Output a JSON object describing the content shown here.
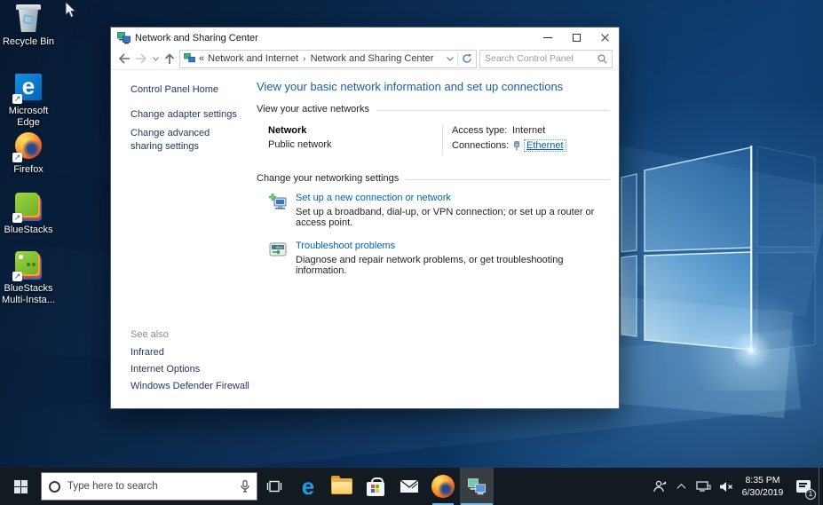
{
  "desktop": {
    "icons": [
      {
        "label": "Recycle Bin"
      },
      {
        "label": "Microsoft Edge"
      },
      {
        "label": "Firefox"
      },
      {
        "label": "BlueStacks"
      },
      {
        "label": "BlueStacks Multi-Insta..."
      }
    ]
  },
  "window": {
    "title": "Network and Sharing Center",
    "breadcrumb": {
      "chevrons": "«",
      "segment1": "Network and Internet",
      "divider": "›",
      "segment2": "Network and Sharing Center"
    },
    "search_placeholder": "Search Control Panel",
    "sidebar": {
      "home": "Control Panel Home",
      "links": [
        "Change adapter settings",
        "Change advanced sharing settings"
      ],
      "see_also_label": "See also",
      "see_also_links": [
        "Infrared",
        "Internet Options",
        "Windows Defender Firewall"
      ]
    },
    "main": {
      "heading": "View your basic network information and set up connections",
      "active_networks_label": "View your active networks",
      "network_name": "Network",
      "network_type": "Public network",
      "access_type_label": "Access type:",
      "access_type_value": "Internet",
      "connections_label": "Connections:",
      "connections_value": "Ethernet",
      "settings_label": "Change your networking settings",
      "items": [
        {
          "title": "Set up a new connection or network",
          "desc": "Set up a broadband, dial-up, or VPN connection; or set up a router or access point."
        },
        {
          "title": "Troubleshoot problems",
          "desc": "Diagnose and repair network problems, or get troubleshooting information."
        }
      ]
    }
  },
  "taskbar": {
    "search_placeholder": "Type here to search",
    "clock_time": "8:35 PM",
    "clock_date": "6/30/2019",
    "notification_badge": "1"
  },
  "colors": {
    "heading_blue": "#1a5dab",
    "link_blue": "#0063b1",
    "taskbar_bg": "#141a22",
    "running_underline": "#76b9ed",
    "wallpaper_base": "#0a2a50"
  }
}
